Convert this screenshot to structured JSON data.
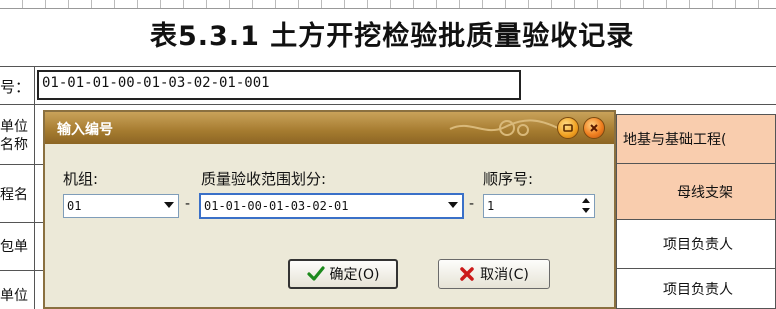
{
  "sheet": {
    "title": "表5.3.1  土方开挖检验批质量验收记录",
    "code_label": "号：",
    "code_value": "01-01-01-00-01-03-02-01-001",
    "left_col": [
      "单位",
      "名称",
      "程名",
      "包单",
      "单位"
    ],
    "right_col": {
      "project_cell": "地基与基础工程(",
      "busbar_cell": "母线支架",
      "manager1": "项目负责人",
      "manager2": "项目负责人"
    }
  },
  "dialog": {
    "title": "输入编号",
    "group_label": "机组:",
    "group_value": "01",
    "range_label": "质量验收范围划分:",
    "range_value": "01-01-00-01-03-02-01",
    "seq_label": "顺序号:",
    "seq_value": "1",
    "dash": "-",
    "ok_label": "确定(O)",
    "cancel_label": "取消(C)"
  },
  "colors": {
    "cell_orange": "#f9cdae",
    "titlebar": "#a57b2f",
    "dialog_bg": "#ece9d8"
  }
}
